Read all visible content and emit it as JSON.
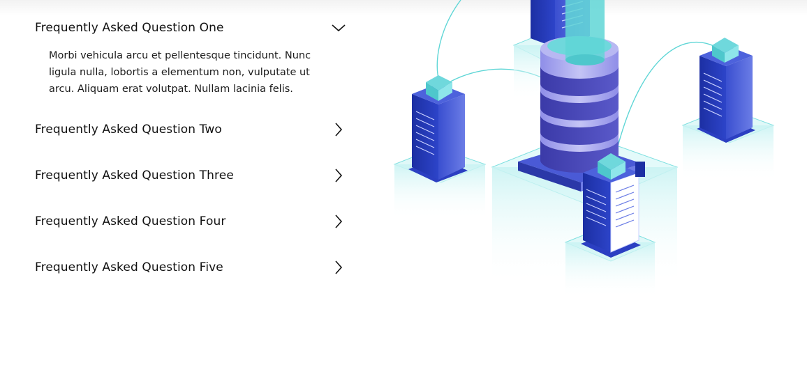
{
  "faq": {
    "items": [
      {
        "question": "Frequently Asked Question One",
        "answer": "Morbi vehicula arcu et pellentesque tincidunt. Nunc ligula nulla, lobortis a elementum non, vulputate ut arcu. Aliquam erat volutpat. Nullam lacinia felis.",
        "expanded": true
      },
      {
        "question": "Frequently Asked Question Two",
        "expanded": false
      },
      {
        "question": "Frequently Asked Question Three",
        "expanded": false
      },
      {
        "question": "Frequently Asked Question Four",
        "expanded": false
      },
      {
        "question": "Frequently Asked Question Five",
        "expanded": false
      }
    ],
    "icons": {
      "expanded": "chevron-down-icon",
      "collapsed": "chevron-right-icon"
    }
  },
  "illustration": {
    "icon": "server-datacenter-illustration",
    "colors": {
      "navy": "#1c2fa3",
      "blue": "#3a4fd0",
      "lavender": "#8f8ee8",
      "cyan": "#5fd6d6",
      "platform": "#c9f3f3"
    }
  }
}
